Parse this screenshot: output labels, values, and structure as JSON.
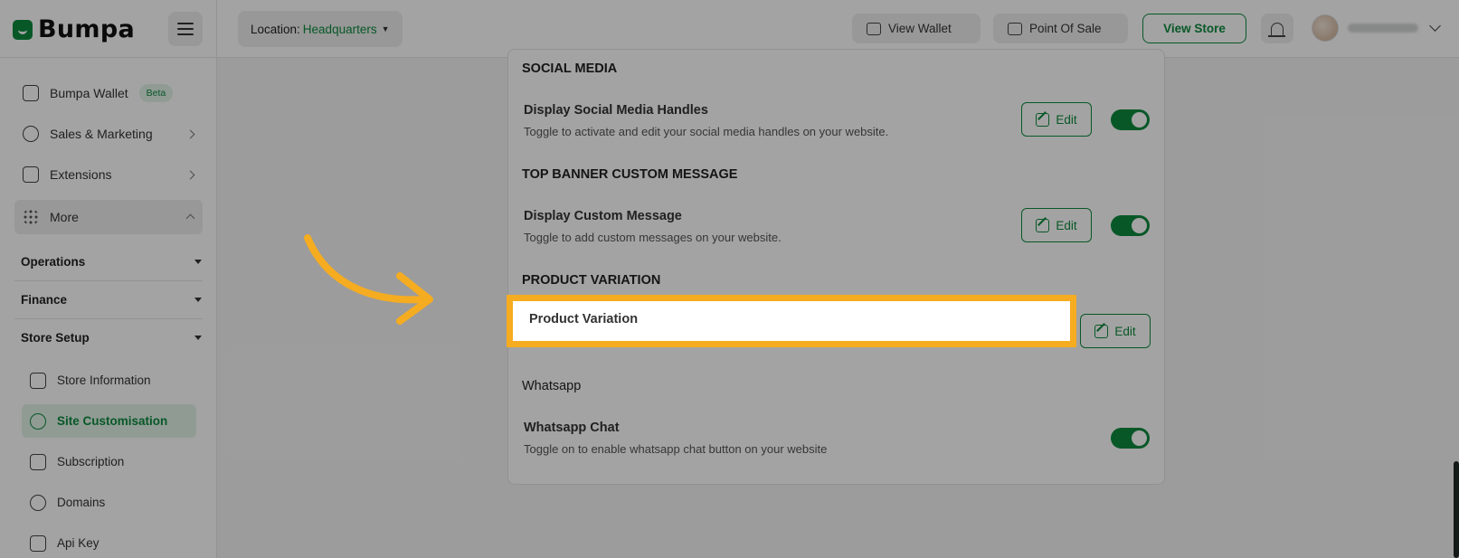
{
  "header": {
    "logo_text": "Bumpa",
    "location_label": "Location:",
    "location_value": "Headquarters",
    "view_wallet": "View Wallet",
    "point_of_sale": "Point Of Sale",
    "view_store": "View Store"
  },
  "sidebar": {
    "items": [
      {
        "label": "Bumpa Wallet",
        "badge": "Beta"
      },
      {
        "label": "Sales & Marketing"
      },
      {
        "label": "Extensions"
      },
      {
        "label": "More"
      }
    ],
    "sections": [
      "Operations",
      "Finance",
      "Store Setup"
    ],
    "store_setup_items": [
      {
        "label": "Store Information"
      },
      {
        "label": "Site Customisation"
      },
      {
        "label": "Subscription"
      },
      {
        "label": "Domains"
      },
      {
        "label": "Api Key"
      }
    ]
  },
  "panel": {
    "social_media": {
      "heading": "SOCIAL MEDIA",
      "title": "Display Social Media Handles",
      "desc": "Toggle to activate and edit your social media handles on your website.",
      "edit": "Edit",
      "enabled": true
    },
    "top_banner": {
      "heading": "TOP BANNER CUSTOM MESSAGE",
      "title": "Display Custom Message",
      "desc": "Toggle to add custom messages on your website.",
      "edit": "Edit",
      "enabled": true
    },
    "product_variation": {
      "heading": "PRODUCT VARIATION",
      "title": "Product Variation",
      "edit": "Edit"
    },
    "whatsapp": {
      "heading": "Whatsapp",
      "title": "Whatsapp Chat",
      "desc": "Toggle on to enable whatsapp chat button on your website",
      "enabled": true
    }
  },
  "colors": {
    "accent": "#0d8a3e",
    "highlight": "#f5ac20"
  }
}
